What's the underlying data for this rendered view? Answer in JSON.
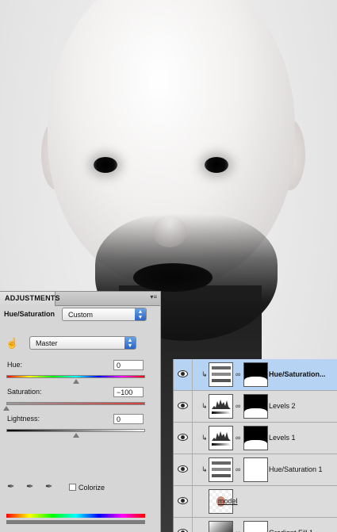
{
  "adjustments": {
    "tab_label": "ADJUSTMENTS",
    "panel_menu_icon": "panel-menu-icon",
    "adjustment_name": "Hue/Saturation",
    "preset_value": "Custom",
    "channel_value": "Master",
    "hue": {
      "label": "Hue:",
      "value": "0",
      "position": 0.5
    },
    "saturation": {
      "label": "Saturation:",
      "value": "−100",
      "position": 0.0
    },
    "lightness": {
      "label": "Lightness:",
      "value": "0",
      "position": 0.5
    },
    "colorize_label": "Colorize",
    "colorize_checked": false
  },
  "layers": [
    {
      "name": "Hue/Saturation...",
      "selected": true,
      "clipped": true,
      "thumb": "hue-sat-thumb",
      "mask": "mask-bottom-white"
    },
    {
      "name": "Levels 2",
      "selected": false,
      "clipped": true,
      "thumb": "levels-thumb",
      "mask": "mask-bottom-white"
    },
    {
      "name": "Levels 1",
      "selected": false,
      "clipped": true,
      "thumb": "levels-thumb",
      "mask": "mask-bottom-white"
    },
    {
      "name": "Hue/Saturation 1",
      "selected": false,
      "clipped": true,
      "thumb": "hue-sat-thumb",
      "mask": "mask-white"
    },
    {
      "name": "model",
      "selected": false,
      "clipped": false,
      "thumb": "photo-thumb",
      "mask": ""
    },
    {
      "name": "Gradient Fill 1",
      "selected": false,
      "clipped": false,
      "thumb": "gradient-thumb",
      "mask": "mask-white"
    }
  ],
  "colors": {
    "selected_layer": "#b6d3f3",
    "panel_bg": "#d6d6d6",
    "select_arrow": "#2a63c6"
  }
}
